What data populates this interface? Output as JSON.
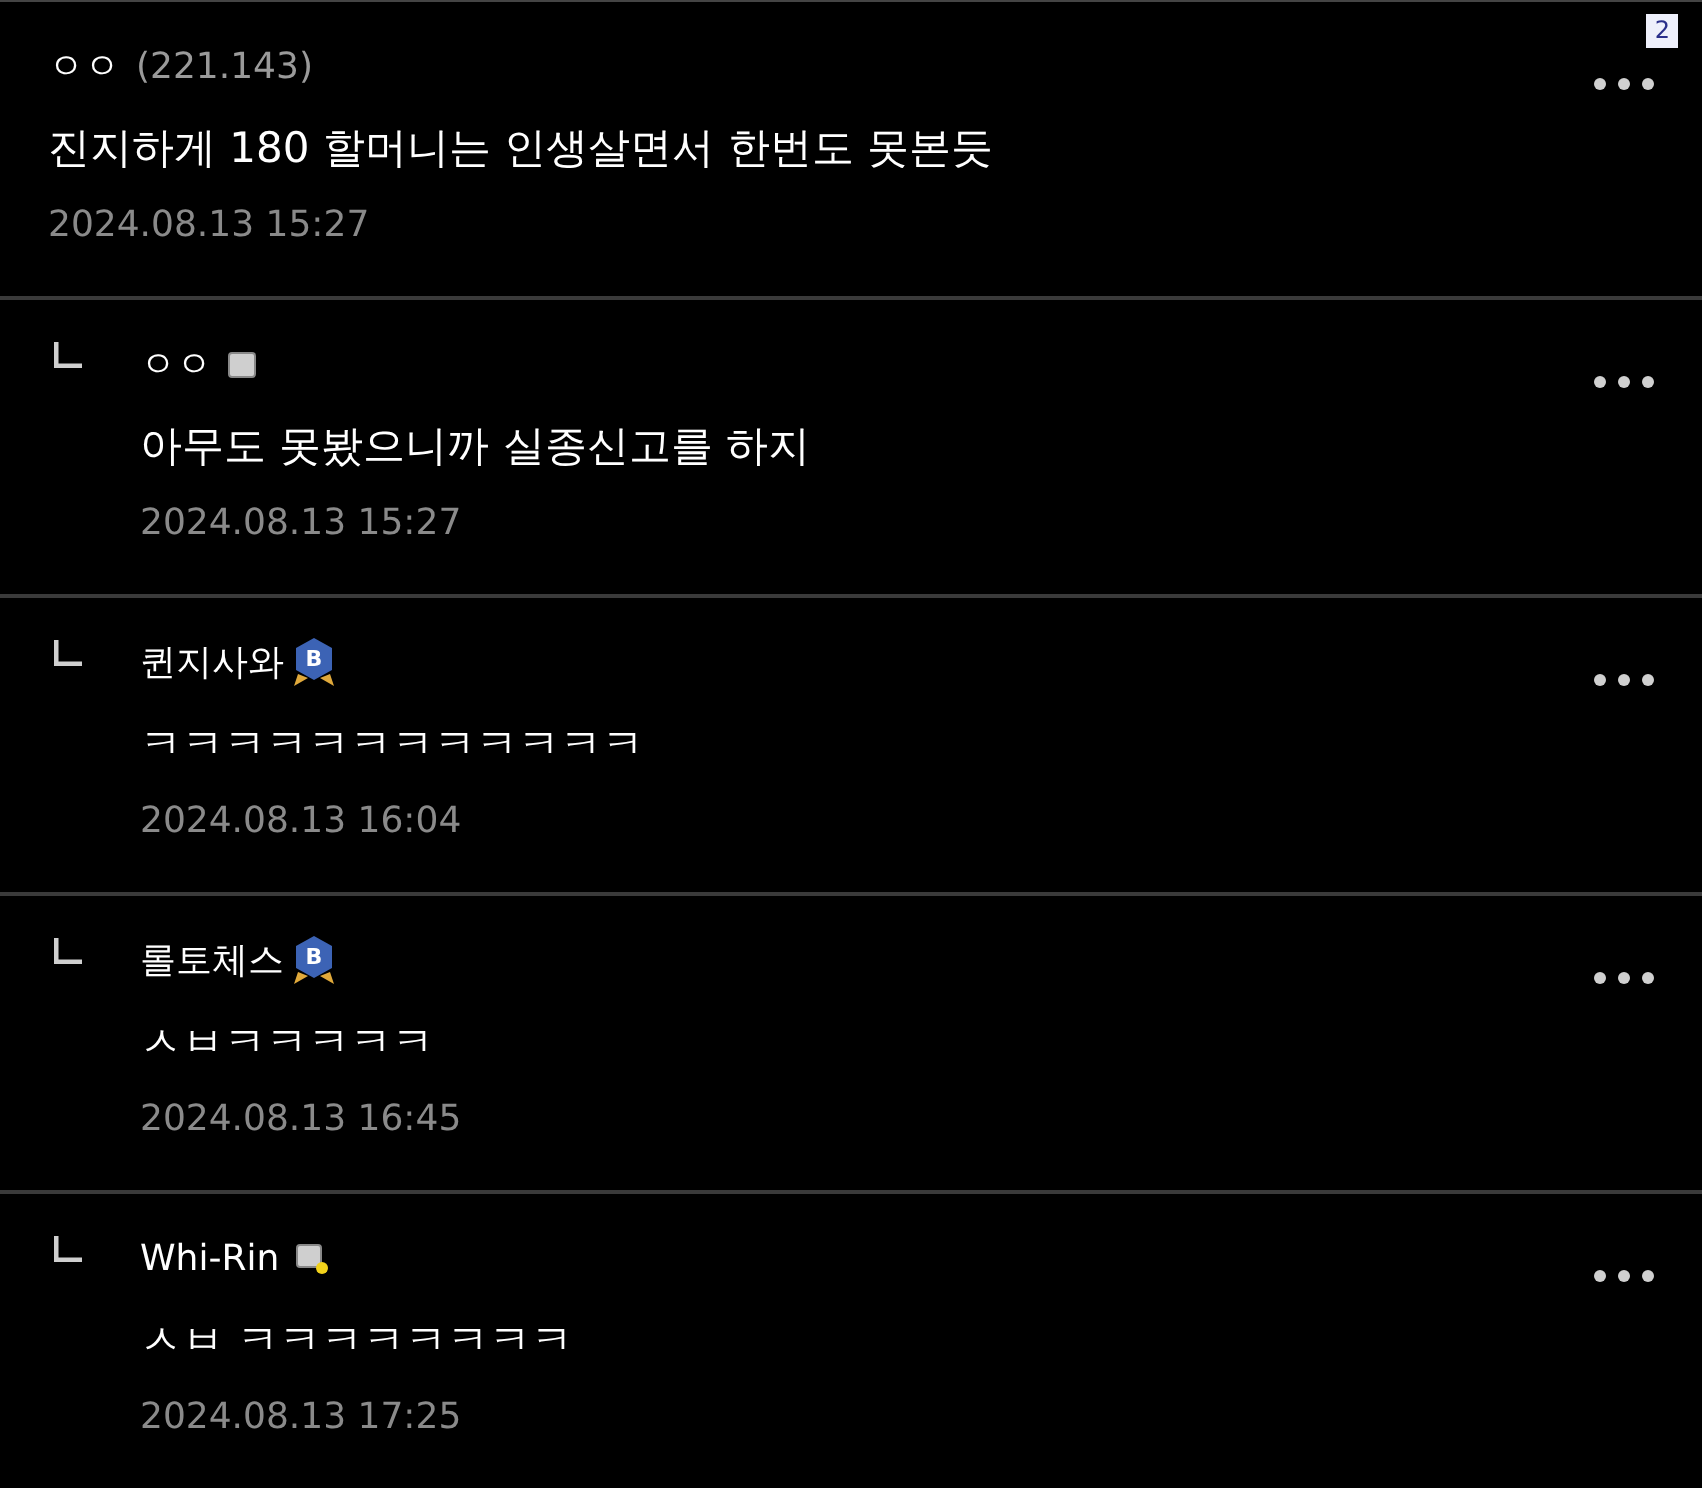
{
  "page_badge": "2",
  "comments": [
    {
      "kind": "comment",
      "author": "ㅇㅇ",
      "ip": "(221.143)",
      "text": "진지하게 180 할머니는 인생살면서 한번도 못본듯",
      "date": "2024.08.13 15:27"
    },
    {
      "kind": "reply",
      "author": "ㅇㅇ",
      "badge": {
        "kind": "gray"
      },
      "text": "아무도 못봤으니까 실종신고를 하지",
      "date": "2024.08.13 15:27"
    },
    {
      "kind": "reply",
      "author": "퀸지사와",
      "badge": {
        "kind": "hex",
        "label": "B"
      },
      "text": "ㅋㅋㅋㅋㅋㅋㅋㅋㅋㅋㅋㅋ",
      "date": "2024.08.13 16:04"
    },
    {
      "kind": "reply",
      "author": "롤토체스",
      "badge": {
        "kind": "hex",
        "label": "B"
      },
      "text": "ㅅㅂㅋㅋㅋㅋㅋ",
      "date": "2024.08.13 16:45"
    },
    {
      "kind": "reply",
      "author": "Whi-Rin",
      "badge": {
        "kind": "gold"
      },
      "text": "ㅅㅂ ㅋㅋㅋㅋㅋㅋㅋㅋ",
      "date": "2024.08.13 17:25"
    }
  ]
}
